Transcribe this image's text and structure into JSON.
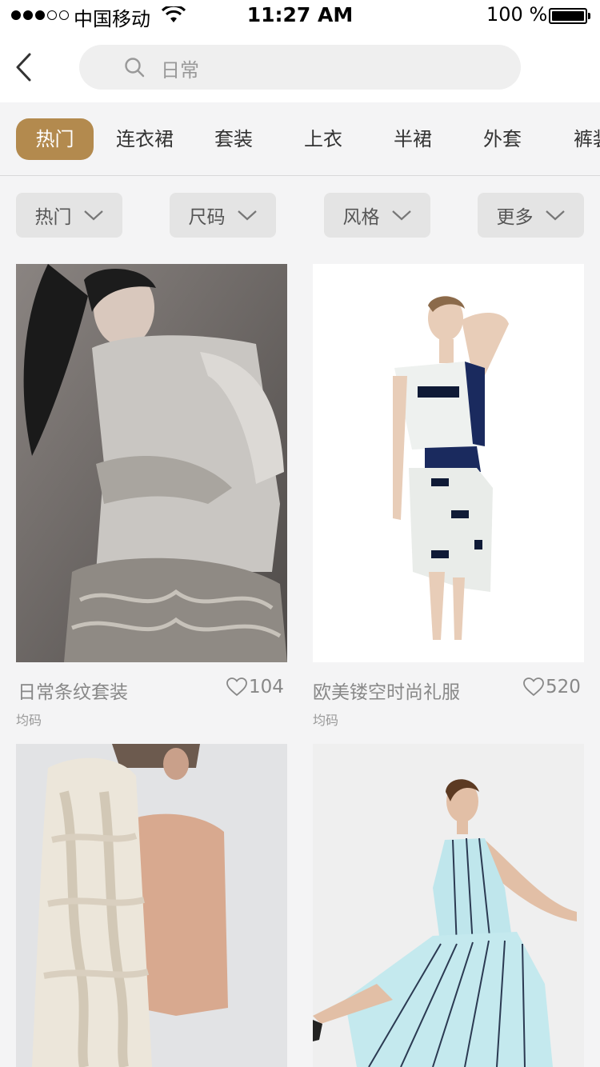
{
  "status": {
    "carrier": "中国移动",
    "time": "11:27 AM",
    "battery": "100 %"
  },
  "search": {
    "text": "日常"
  },
  "tabs": [
    "热门",
    "连衣裙",
    "套装",
    "上衣",
    "半裙",
    "外套",
    "裤装"
  ],
  "filters": [
    "热门",
    "尺码",
    "风格",
    "更多"
  ],
  "products": [
    {
      "title": "日常条纹套装",
      "likes": "104",
      "size": "均码"
    },
    {
      "title": "欧美镂空时尚礼服",
      "likes": "520",
      "size": "均码"
    },
    {
      "title": "",
      "likes": "",
      "size": ""
    },
    {
      "title": "",
      "likes": "",
      "size": ""
    }
  ],
  "colors": {
    "accent": "#b38a4e",
    "background": "#f4f4f5",
    "filter_bg": "#e4e4e4"
  }
}
